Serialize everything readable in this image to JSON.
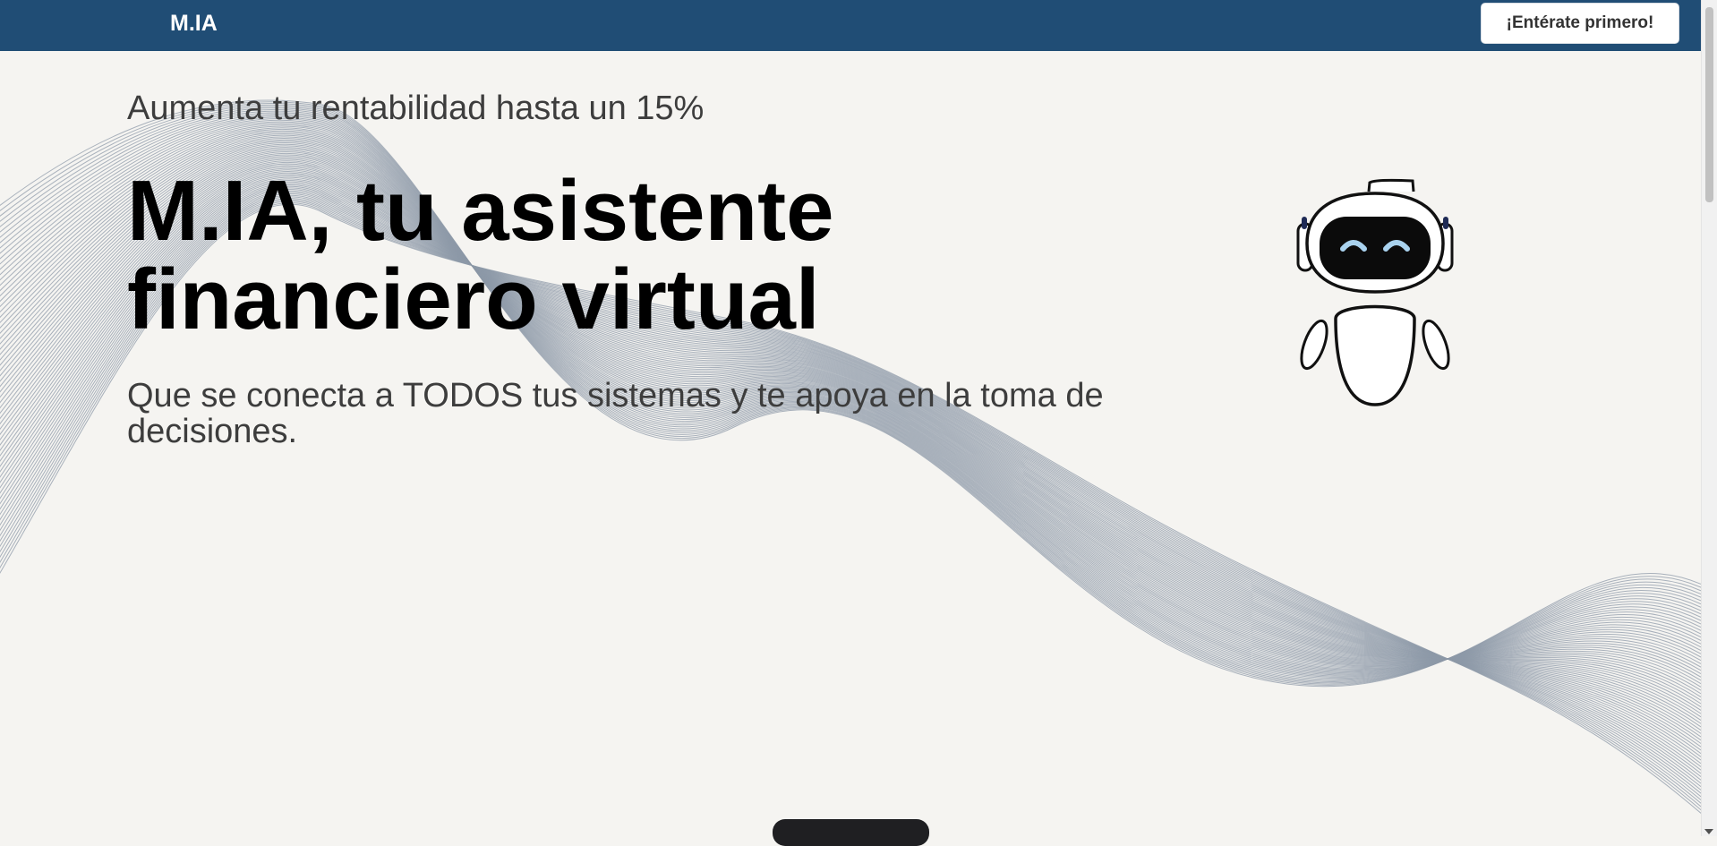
{
  "navbar": {
    "brand": "M.IA",
    "cta_label": "¡Entérate primero!",
    "background_color": "#204d75"
  },
  "hero": {
    "eyebrow": "Aumenta tu rentabilidad hasta un 15%",
    "headline_line1": "M.IA, tu asistente",
    "headline_line2": "financiero virtual",
    "subtitle": "Que se conecta a TODOS tus sistemas y te apoya en la toma de decisiones."
  },
  "illustration": {
    "robot_icon": "robot-mascot-icon",
    "wave_color": "#8d9aa8",
    "visor_color": "#0b0b0b",
    "eye_color": "#a9d2ee"
  },
  "colors": {
    "page_background": "#f5f4f1",
    "headline_text": "#000000",
    "body_text": "#3d3d3d"
  }
}
